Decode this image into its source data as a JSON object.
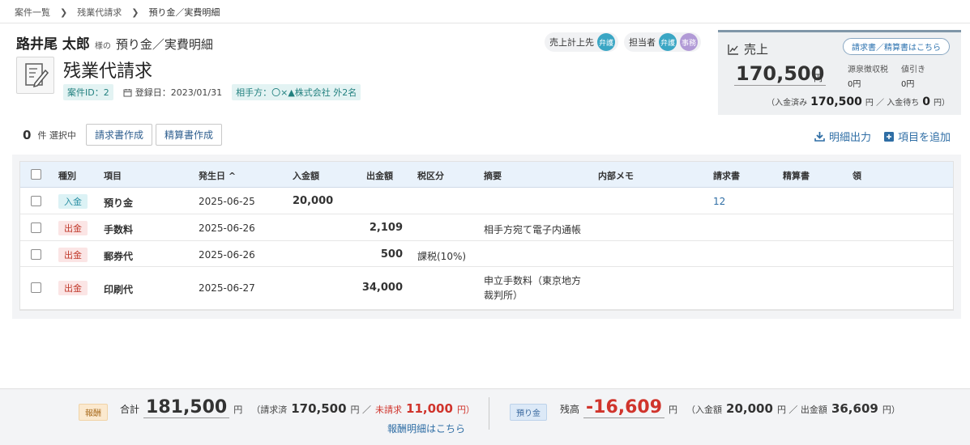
{
  "breadcrumb": [
    "案件一覧",
    "残業代請求",
    "預り金／実費明細"
  ],
  "header": {
    "client_name": "路井尾 太郎",
    "honorific": "様の",
    "subtitle": "預り金／実費明細",
    "title": "残業代請求",
    "case_id": "案件ID：2",
    "registered": "登録日：2023/01/31",
    "opponent": "相手方：〇×▲株式会社 外2名"
  },
  "assign": {
    "sales_label": "売上計上先",
    "sales_badge": "弁護",
    "staff_label": "担当者",
    "staff_badges": [
      "弁護",
      "事務"
    ]
  },
  "sales_panel": {
    "label": "売上",
    "link": "請求書／精算書はこちら",
    "amount": "170,500",
    "yen": "円",
    "withholding_label": "源泉徴収税",
    "withholding_value": "0円",
    "discount_label": "値引き",
    "discount_value": "0円",
    "paid_prefix": "（入金済み",
    "paid_amount": "170,500",
    "paid_mid": "円 ／ 入金待ち",
    "waiting_amount": "0",
    "waiting_suffix": "円）"
  },
  "toolbar": {
    "selected_count": "0",
    "selected_text": "件 選択中",
    "invoice_button": "請求書作成",
    "settlement_button": "精算書作成",
    "export_label": "明細出力",
    "add_label": "項目を追加"
  },
  "table": {
    "headers": [
      "種別",
      "項目",
      "発生日",
      "入金額",
      "出金額",
      "税区分",
      "摘要",
      "内部メモ",
      "請求書",
      "精算書",
      "領"
    ],
    "rows": [
      {
        "type": "入金",
        "item": "預り金",
        "date": "2025-06-25",
        "in": "20,000",
        "out": "",
        "tax": "",
        "summary": [
          "",
          ""
        ],
        "memo": "",
        "invoice": "12"
      },
      {
        "type": "出金",
        "item": "手数料",
        "date": "2025-06-26",
        "in": "",
        "out": "2,109",
        "tax": "",
        "summary": [
          "相手方宛て電子内通帳",
          ""
        ],
        "memo": "",
        "invoice": ""
      },
      {
        "type": "出金",
        "item": "郵券代",
        "date": "2025-06-26",
        "in": "",
        "out": "500",
        "tax": "課税(10%)",
        "summary": [
          "",
          ""
        ],
        "memo": "",
        "invoice": ""
      },
      {
        "type": "出金",
        "item": "印刷代",
        "date": "2025-06-27",
        "in": "",
        "out": "34,000",
        "tax": "",
        "summary": [
          "申立手数料（東京地方",
          "裁判所）"
        ],
        "memo": "",
        "invoice": ""
      }
    ]
  },
  "footer": {
    "fee_tag": "報酬",
    "total_label": "合計",
    "total_amount": "181,500",
    "yen": "円",
    "billed_prefix": "（請求済",
    "billed_amount": "170,500",
    "billed_mid": "円 ／",
    "unbilled_label": "未請求",
    "unbilled_amount": "11,000",
    "unbilled_suffix": "円）",
    "fee_link": "報酬明細はこちら",
    "deposit_tag": "預り金",
    "balance_label": "残高",
    "balance_amount": "-16,609",
    "in_prefix": "（入金額",
    "in_amount": "20,000",
    "out_mid": "円 ／ 出金額",
    "out_amount": "36,609",
    "out_suffix": "円）"
  },
  "colors": {
    "accent": "#2f6ea5",
    "teal": "#3aa6c4",
    "negative": "#d0342c"
  }
}
